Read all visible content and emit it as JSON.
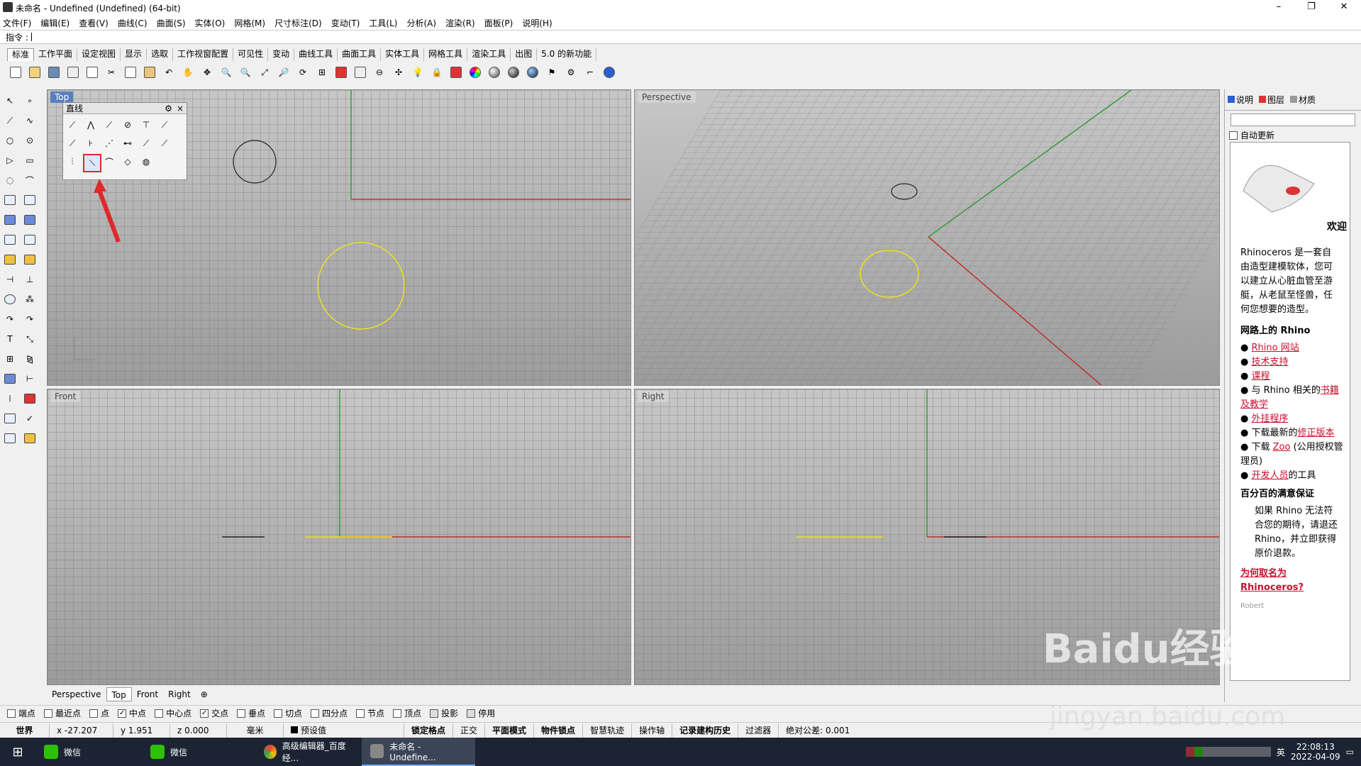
{
  "window": {
    "title": "未命名 - Undefined (Undefined) (64-bit)",
    "min": "–",
    "max": "❐",
    "close": "✕"
  },
  "menu": [
    "文件(F)",
    "编辑(E)",
    "查看(V)",
    "曲线(C)",
    "曲面(S)",
    "实体(O)",
    "网格(M)",
    "尺寸标注(D)",
    "变动(T)",
    "工具(L)",
    "分析(A)",
    "渲染(R)",
    "面板(P)",
    "说明(H)"
  ],
  "command": {
    "label": "指令 :"
  },
  "toolbar_tabs": [
    "标准",
    "工作平面",
    "设定视图",
    "显示",
    "选取",
    "工作视窗配置",
    "可见性",
    "变动",
    "曲线工具",
    "曲面工具",
    "实体工具",
    "网格工具",
    "渲染工具",
    "出图",
    "5.0 的新功能"
  ],
  "viewports": {
    "top": "Top",
    "perspective": "Perspective",
    "front": "Front",
    "right": "Right"
  },
  "line_panel": {
    "title": "直线",
    "gear": "⚙",
    "close": "×"
  },
  "bottom_tabs": [
    "Perspective",
    "Top",
    "Front",
    "Right"
  ],
  "add_tab": "⊕",
  "osnaps": [
    {
      "label": "端点",
      "checked": false
    },
    {
      "label": "最近点",
      "checked": false
    },
    {
      "label": "点",
      "checked": false
    },
    {
      "label": "中点",
      "checked": true
    },
    {
      "label": "中心点",
      "checked": false
    },
    {
      "label": "交点",
      "checked": true
    },
    {
      "label": "垂点",
      "checked": false
    },
    {
      "label": "切点",
      "checked": false
    },
    {
      "label": "四分点",
      "checked": false
    },
    {
      "label": "节点",
      "checked": false
    },
    {
      "label": "顶点",
      "checked": false
    },
    {
      "label": "投影",
      "checked": false
    },
    {
      "label": "停用",
      "checked": false
    }
  ],
  "status": {
    "cplane": "世界",
    "x": "x -27.207",
    "y": "y 1.951",
    "z": "z 0.000",
    "unit": "毫米",
    "layer": "预设值",
    "toggles": [
      "锁定格点",
      "正交",
      "平面模式",
      "物件锁点",
      "智慧轨迹",
      "操作轴",
      "记录建构历史",
      "过滤器"
    ],
    "tolerance": "绝对公差: 0.001"
  },
  "right_panel": {
    "tabs": [
      "说明",
      "图层",
      "材质"
    ],
    "auto_update": "自动更新",
    "welcome": "欢迎",
    "intro": "Rhinoceros 是一套自由造型建模软体，您可以建立从心脏血管至游艇，从老鼠至怪兽，任何您想要的造型。",
    "online_heading": "网路上的 Rhino",
    "links": [
      {
        "pre": "",
        "link": "Rhino 网站",
        "post": ""
      },
      {
        "pre": "",
        "link": "技术支持",
        "post": ""
      },
      {
        "pre": "",
        "link": "课程",
        "post": ""
      },
      {
        "pre": "与 Rhino 相关的",
        "link": "书籍及教学",
        "post": ""
      },
      {
        "pre": "",
        "link": "外挂程序",
        "post": ""
      },
      {
        "pre": "下载最新的",
        "link": "修正版本",
        "post": ""
      },
      {
        "pre": "下载 ",
        "link": "Zoo",
        "post": " (公用授权管理员)"
      },
      {
        "pre": "",
        "link": "开发人员",
        "post": "的工具"
      }
    ],
    "guarantee_heading": "百分百的满意保证",
    "guarantee": "如果 Rhino 无法符合您的期待，请退还 Rhino，并立即获得原价退款。",
    "why_link": "为何取名为 Rhinoceros?",
    "robert": "Robert"
  },
  "taskbar": {
    "items": [
      "微信",
      "微信",
      "高级编辑器_百度经...",
      "未命名 - Undefine..."
    ],
    "time": "22:08:13",
    "date": "2022-04-09",
    "ime": "英"
  },
  "watermark": {
    "text": "Baidu经验",
    "url": "jingyan.baidu.com"
  },
  "colors": {
    "x_axis": "#c0302a",
    "y_axis": "#3a9a3a",
    "selected_curve": "#f0e020",
    "highlight": "#e0282a"
  }
}
